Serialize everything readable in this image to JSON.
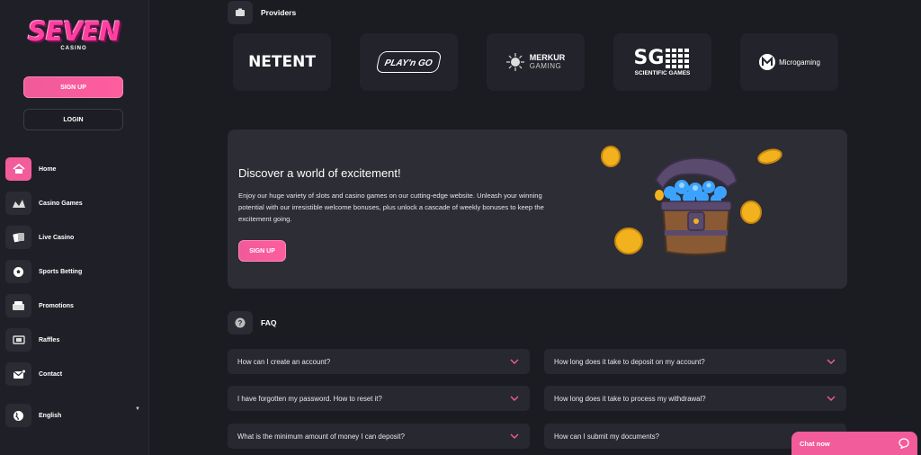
{
  "brand": {
    "name": "SEVEN",
    "sub": "CASINO"
  },
  "auth": {
    "signup_label": "SIGN UP",
    "login_label": "LOGIN"
  },
  "nav": [
    {
      "label": "Home",
      "icon": "home-icon",
      "active": true
    },
    {
      "label": "Casino Games",
      "icon": "casino-games-icon"
    },
    {
      "label": "Live Casino",
      "icon": "cards-icon"
    },
    {
      "label": "Sports Betting",
      "icon": "soccer-ball-icon"
    },
    {
      "label": "Promotions",
      "icon": "promotions-icon"
    },
    {
      "label": "Raffles",
      "icon": "ticket-icon"
    },
    {
      "label": "Contact",
      "icon": "mail-icon"
    }
  ],
  "language": {
    "label": "English",
    "icon": "globe-icon"
  },
  "providers": {
    "title": "Providers",
    "items": [
      {
        "name": "NETENT"
      },
      {
        "name": "PLAY'n GO"
      },
      {
        "name": "MERKUR",
        "sub": "GAMING"
      },
      {
        "name": "SG",
        "sub": "SCIENTIFIC GAMES"
      },
      {
        "name": "Microgaming"
      }
    ]
  },
  "banner": {
    "title": "Discover a world of excitement!",
    "text": "Enjoy our huge variety of slots and casino games on our cutting-edge website. Unleash your winning potential with our irresistible welcome bonuses, plus unlock a cascade of weekly bonuses to keep the excitement going.",
    "button": "SIGN UP"
  },
  "faq": {
    "title": "FAQ",
    "questions": [
      "How can I create an account?",
      "How long does it take to deposit on my account?",
      "I have forgotten my password. How to reset it?",
      "How long does it take to process my withdrawal?",
      "What is the minimum amount of money I can deposit?",
      "How can I submit my documents?"
    ]
  },
  "chat": {
    "label": "Chat now"
  },
  "colors": {
    "accent": "#f35c9a",
    "background": "#1b1c22",
    "sidebar": "#1f2027",
    "card": "#2c2d35"
  }
}
